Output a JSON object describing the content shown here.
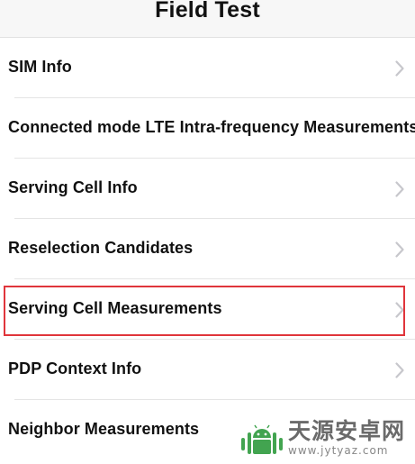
{
  "nav": {
    "title": "Field Test"
  },
  "list": {
    "items": [
      {
        "label": "SIM Info",
        "name": "list-item-sim-info"
      },
      {
        "label": "Connected mode LTE Intra-frequency Measurements",
        "name": "list-item-lte-intra-frequency"
      },
      {
        "label": "Serving Cell Info",
        "name": "list-item-serving-cell-info"
      },
      {
        "label": "Reselection Candidates",
        "name": "list-item-reselection-candidates"
      },
      {
        "label": "Serving Cell Measurements",
        "name": "list-item-serving-cell-measurements",
        "highlighted": true
      },
      {
        "label": "PDP Context Info",
        "name": "list-item-pdp-context-info"
      },
      {
        "label": "Neighbor Measurements",
        "name": "list-item-neighbor-measurements"
      }
    ]
  },
  "watermark": {
    "name": "天源安卓网",
    "url": "www.jytyaz.com",
    "brand_color": "#2e9b3e"
  },
  "colors": {
    "highlight": "#e0353b",
    "chevron": "#c7c7cc"
  }
}
